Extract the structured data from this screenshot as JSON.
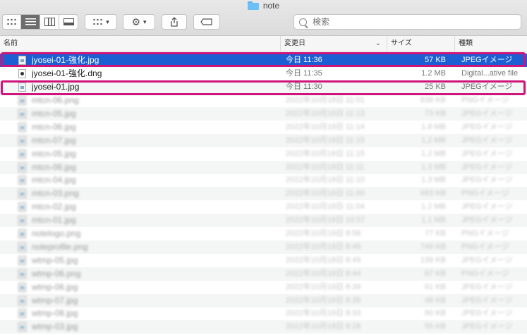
{
  "window": {
    "title": "note"
  },
  "search": {
    "placeholder": "検索"
  },
  "columns": {
    "name": "名前",
    "date": "変更日",
    "size": "サイズ",
    "kind": "種類"
  },
  "files": [
    {
      "name": "jyosei-01-強化.jpg",
      "date": "今日 11:36",
      "size": "57 KB",
      "kind": "JPEGイメージ",
      "icon": "jpeg-file-icon",
      "selected": true
    },
    {
      "name": "jyosei-01-強化.dng",
      "date": "今日 11:35",
      "size": "1.2 MB",
      "kind": "Digital...ative file",
      "icon": "dng-file-icon"
    },
    {
      "name": "jyosei-01.jpg",
      "date": "今日 11:30",
      "size": "25 KB",
      "kind": "JPEGイメージ",
      "icon": "jpeg-file-icon"
    }
  ],
  "blurred_files": [
    {
      "name": "mtcn-06.png",
      "date": "2022年10月18日 11:01",
      "size": "838 KB",
      "kind": "PNGイメージ"
    },
    {
      "name": "mtcn-05.jpg",
      "date": "2022年10月18日 11:13",
      "size": "73 KB",
      "kind": "JPEGイメージ"
    },
    {
      "name": "mtcn-06.jpg",
      "date": "2022年10月18日 11:14",
      "size": "1.8 MB",
      "kind": "JPEGイメージ"
    },
    {
      "name": "mtcn-07.jpg",
      "date": "2022年10月18日 11:15",
      "size": "1.2 MB",
      "kind": "JPEGイメージ"
    },
    {
      "name": "mtcn-05.jpg",
      "date": "2022年10月18日 11:15",
      "size": "1.2 MB",
      "kind": "JPEGイメージ"
    },
    {
      "name": "mtcn-06.jpg",
      "date": "2022年10月18日 11:11",
      "size": "1.3 MB",
      "kind": "JPEGイメージ"
    },
    {
      "name": "mtcn-04.jpg",
      "date": "2022年10月18日 11:10",
      "size": "1.3 MB",
      "kind": "JPEGイメージ"
    },
    {
      "name": "mtcn-03.png",
      "date": "2022年10月18日 11:00",
      "size": "683 KB",
      "kind": "PNGイメージ"
    },
    {
      "name": "mtcn-02.jpg",
      "date": "2022年10月18日 11:04",
      "size": "1.2 MB",
      "kind": "JPEGイメージ"
    },
    {
      "name": "mtcn-01.jpg",
      "date": "2022年10月18日 10:57",
      "size": "1.1 MB",
      "kind": "JPEGイメージ"
    },
    {
      "name": "notelogo.png",
      "date": "2022年10月18日 8:58",
      "size": "77 KB",
      "kind": "PNGイメージ"
    },
    {
      "name": "noteprofile.png",
      "date": "2022年10月18日 8:49",
      "size": "749 KB",
      "kind": "PNGイメージ"
    },
    {
      "name": "wtmp-05.jpg",
      "date": "2022年10月18日 8:49",
      "size": "139 KB",
      "kind": "JPEGイメージ"
    },
    {
      "name": "wtmp-06.png",
      "date": "2022年10月18日 8:44",
      "size": "67 KB",
      "kind": "PNGイメージ"
    },
    {
      "name": "wtmp-06.jpg",
      "date": "2022年10月18日 8:39",
      "size": "61 KB",
      "kind": "JPEGイメージ"
    },
    {
      "name": "wtmp-07.jpg",
      "date": "2022年10月18日 8:35",
      "size": "48 KB",
      "kind": "JPEGイメージ"
    },
    {
      "name": "wtmp-08.jpg",
      "date": "2022年10月18日 8:33",
      "size": "60 KB",
      "kind": "JPEGイメージ"
    },
    {
      "name": "wtmp-03.jpg",
      "date": "2022年10月18日 8:28",
      "size": "55 KB",
      "kind": "JPEGイメージ"
    }
  ],
  "colors": {
    "selection": "#1b5fd3",
    "highlight": "#d0157a",
    "folder": "#6cc0f7"
  }
}
